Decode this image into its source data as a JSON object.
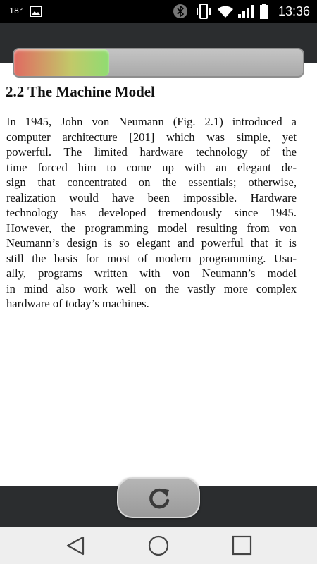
{
  "status_bar": {
    "temperature": "18°",
    "clock": "13:36",
    "icons": [
      "image-icon",
      "bluetooth-icon",
      "vibrate-icon",
      "wifi-icon",
      "signal-icon",
      "battery-icon"
    ]
  },
  "progress": {
    "fraction": 0.33,
    "colors": {
      "start": "#e06a62",
      "mid": "#c2c969",
      "end": "#8fdc72"
    }
  },
  "document": {
    "section_title": "2.2  The Machine Model",
    "paragraph_lines": [
      "In 1945, John von Neumann (Fig. 2.1) introduced a",
      "computer architecture [201] which was simple, yet",
      "powerful. The limited hardware technology of the",
      "time forced him to come up with an elegant de-",
      "sign that concentrated on the essentials; otherwise,",
      "realization would have been impossible. Hardware",
      "technology has developed tremendously since 1945.",
      "However, the programming model resulting from von",
      "Neumann’s design is so elegant and powerful that it is",
      "still the basis for most of modern programming. Usu-",
      "ally, programs written with von Neumann’s model",
      "in mind also work well on the vastly more complex",
      "hardware of today’s machines."
    ]
  },
  "controls": {
    "refresh_icon": "refresh-icon"
  },
  "nav_bar": {
    "items": [
      "back-icon",
      "home-icon",
      "recents-icon"
    ]
  }
}
